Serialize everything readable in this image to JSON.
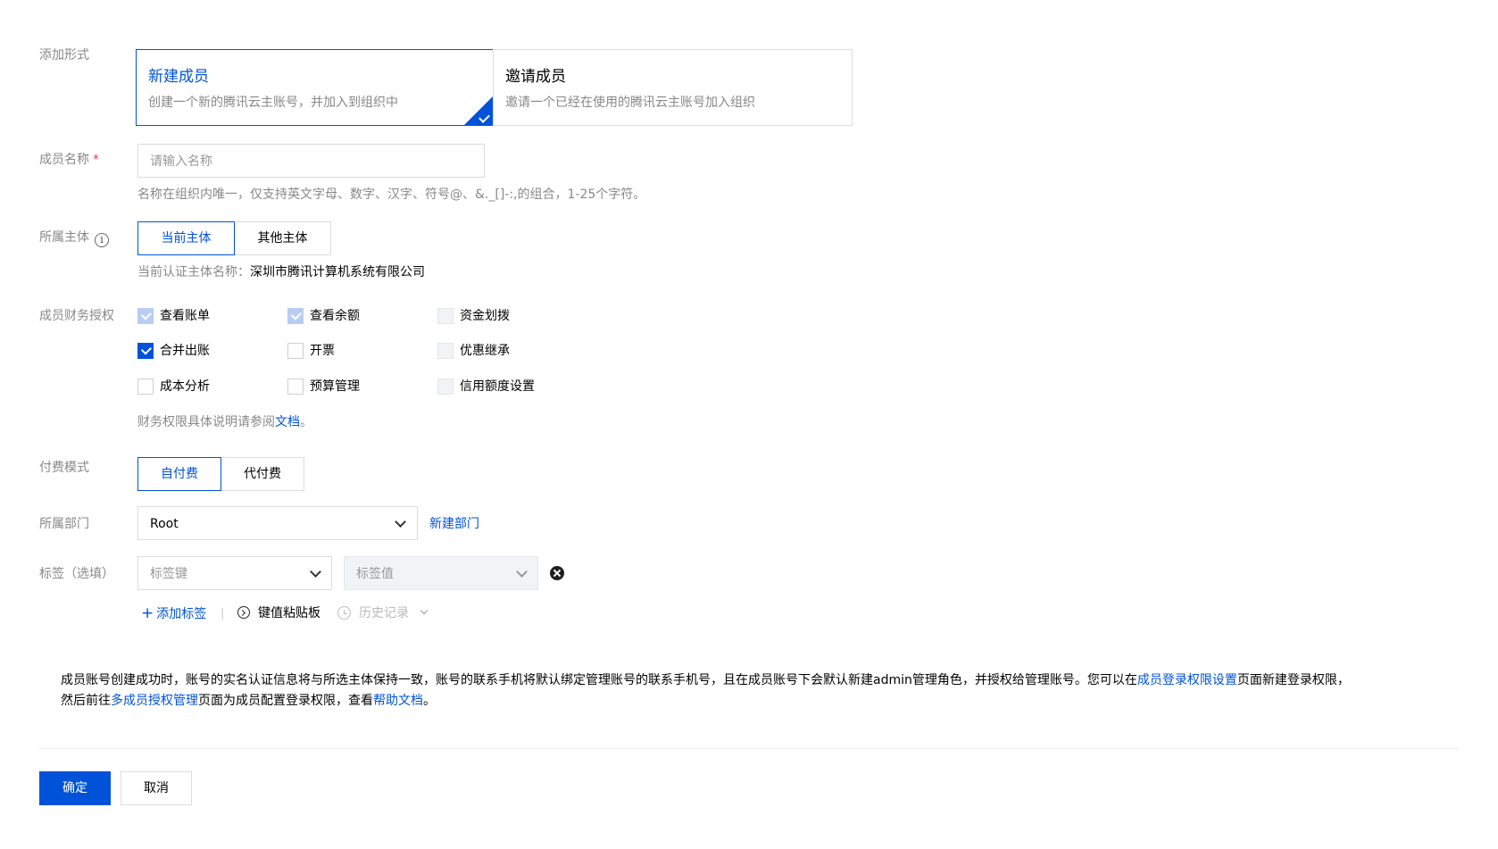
{
  "add_form": {
    "label": "添加形式",
    "options": [
      {
        "title": "新建成员",
        "desc": "创建一个新的腾讯云主账号，并加入到组织中"
      },
      {
        "title": "邀请成员",
        "desc": "邀请一个已经在使用的腾讯云主账号加入组织"
      }
    ]
  },
  "member_name": {
    "label": "成员名称",
    "required_mark": "*",
    "placeholder": "请输入名称",
    "hint": "名称在组织内唯一，仅支持英文字母、数字、汉字、符号@、&._[]-:,的组合，1-25个字符。"
  },
  "entity": {
    "label": "所属主体",
    "info_glyph": "i",
    "options": [
      "当前主体",
      "其他主体"
    ],
    "cert_label": "当前认证主体名称：",
    "cert_value": "深圳市腾讯计算机系统有限公司"
  },
  "finance": {
    "label": "成员财务授权",
    "items": [
      {
        "label": "查看账单",
        "state": "disabled-checked"
      },
      {
        "label": "查看余额",
        "state": "disabled-checked"
      },
      {
        "label": "资金划拨",
        "state": "disabled"
      },
      {
        "label": "合并出账",
        "state": "checked"
      },
      {
        "label": "开票",
        "state": "unchecked"
      },
      {
        "label": "优惠继承",
        "state": "disabled"
      },
      {
        "label": "成本分析",
        "state": "unchecked"
      },
      {
        "label": "预算管理",
        "state": "unchecked"
      },
      {
        "label": "信用额度设置",
        "state": "disabled"
      }
    ],
    "hint_prefix": "财务权限具体说明请参阅",
    "hint_link": "文档",
    "hint_suffix": "。"
  },
  "payment": {
    "label": "付费模式",
    "options": [
      "自付费",
      "代付费"
    ]
  },
  "department": {
    "label": "所属部门",
    "value": "Root",
    "new_link": "新建部门"
  },
  "tags": {
    "label": "标签（选填）",
    "key_placeholder": "标签键",
    "value_placeholder": "标签值",
    "add_label": "添加标签",
    "add_glyph": "+",
    "separator": "|",
    "clipboard_label": "键值粘贴板",
    "history_label": "历史记录"
  },
  "notice": {
    "part1": "成员账号创建成功时，账号的实名认证信息将与所选主体保持一致，账号的联系手机将默认绑定管理账号的联系手机号，且在成员账号下会默认新建admin管理角色，并授权给管理账号。您可以在",
    "link1": "成员登录权限设置",
    "part2": "页面新建登录权限，",
    "part3": "然后前往",
    "link2": "多成员授权管理",
    "part4": "页面为成员配置登录权限，查看",
    "link3": "帮助文档",
    "part5": "。"
  },
  "actions": {
    "confirm": "确定",
    "cancel": "取消"
  },
  "colors": {
    "primary": "#0052d9",
    "border": "#dcdcdc",
    "muted": "#888888"
  }
}
